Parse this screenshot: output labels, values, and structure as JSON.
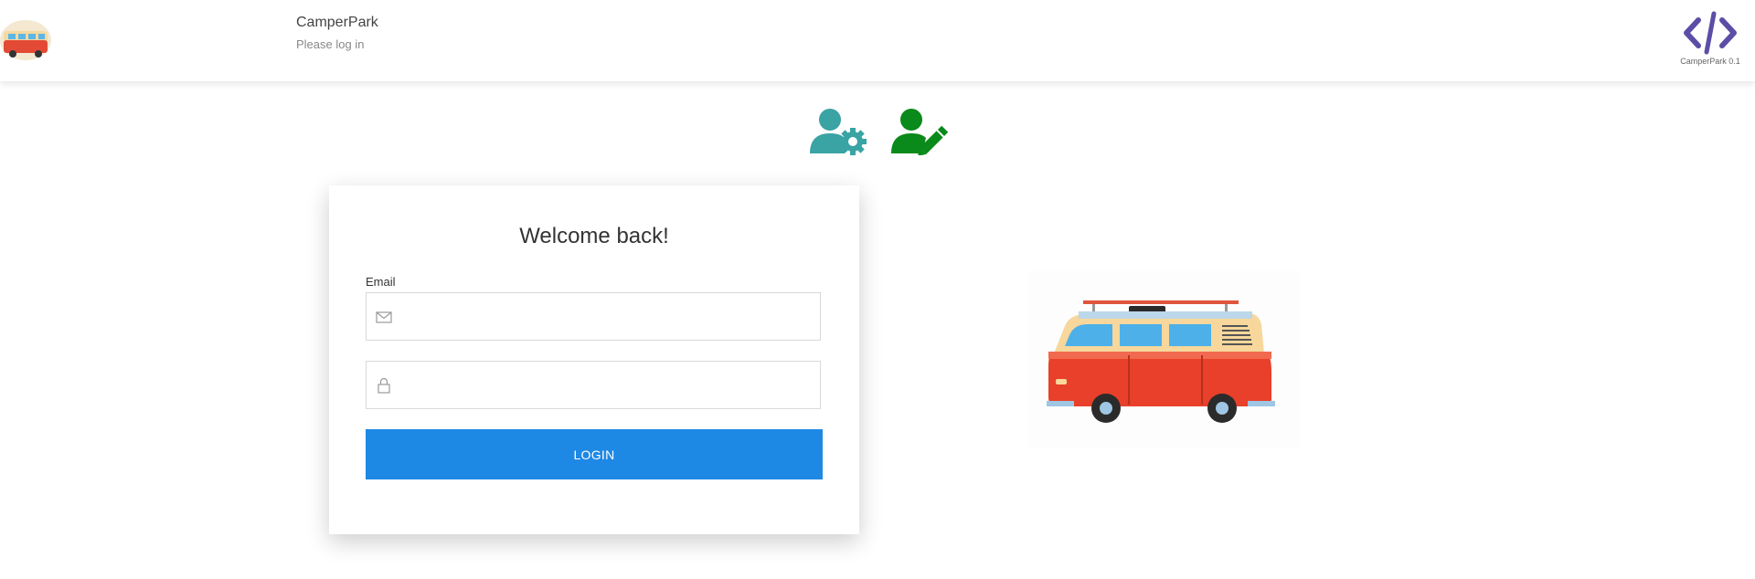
{
  "header": {
    "app_name": "CamperPark",
    "subtitle": "Please log in",
    "brand_version": "CamperPark 0.1"
  },
  "roles": [
    {
      "name": "admin",
      "icon": "user-gear-icon",
      "color": "#3aa3a3"
    },
    {
      "name": "editor",
      "icon": "user-pen-icon",
      "color": "#0a8a1a"
    }
  ],
  "login": {
    "title": "Welcome back!",
    "email_label": "Email",
    "email_value": "",
    "password_value": "",
    "button_label": "LOGIN",
    "email_icon": "envelope-icon",
    "password_icon": "lock-icon"
  },
  "colors": {
    "primary": "#1e88e5",
    "brand": "#5b4ea6",
    "van_body": "#e8402a",
    "van_top": "#f7d79b"
  }
}
